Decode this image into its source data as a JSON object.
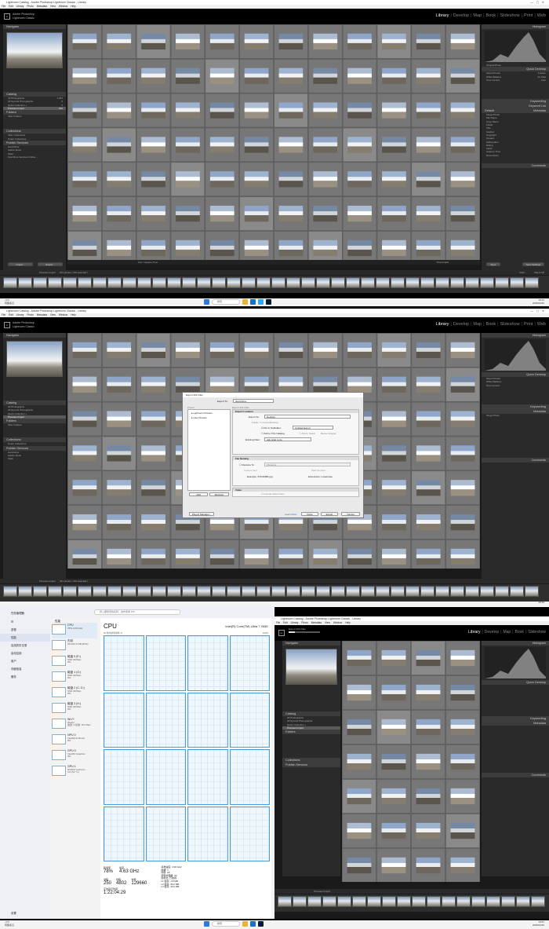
{
  "app": {
    "title": "Lightroom Catalog - Adobe Photoshop Lightroom Classic - Library",
    "brand_small": "Adobe Photoshop",
    "brand_name": "Lightroom Classic",
    "menus": [
      "File",
      "Edit",
      "Library",
      "Photo",
      "Metadata",
      "View",
      "Window",
      "Help"
    ],
    "modules": [
      "Library",
      "Develop",
      "Map",
      "Book",
      "Slideshow",
      "Print",
      "Web"
    ],
    "active_module": "Library"
  },
  "left_panel": {
    "navigator_label": "Navigator",
    "navigator_zoom": "FIT  FILL  1:1  3:1",
    "catalog_label": "Catalog",
    "catalog_items": [
      {
        "label": "All Photographs",
        "count": "1,251"
      },
      {
        "label": "All Synced Photographs",
        "count": "0"
      },
      {
        "label": "Quick Collection +",
        "count": "0"
      },
      {
        "label": "Previous Import",
        "count": "331"
      }
    ],
    "folders_label": "Folders",
    "filter_folders": "Filter Folders",
    "collections_label": "Collections",
    "filter_collections": "Filter Collections",
    "smart_collections": "Smart Collections",
    "publish_label": "Publish Services",
    "publish_items": [
      "Hard Drive",
      "Adobe Stock",
      "Flickr"
    ],
    "find_more": "Find More Services Online...",
    "import_btn": "Import...",
    "export_btn": "Export..."
  },
  "toolbar": {
    "sort_label": "Sort:",
    "sort_value": "Capture Time",
    "thumbnails_label": "Thumbnails"
  },
  "filmstrip_bar": {
    "source": "Previous Import",
    "count_text": "331 photos / 331 selected /",
    "filter_label": "Filter:",
    "filter_value": "Filters Off"
  },
  "right_panel": {
    "histogram_label": "Histogram",
    "histogram_info": "Original Photo",
    "quick_develop_label": "Quick Develop",
    "saved_preset_label": "Saved Preset",
    "saved_preset_value": "Custom",
    "white_balance_label": "White Balance",
    "white_balance_value": "As Shot",
    "tone_control_label": "Tone Control",
    "tone_control_value": "Auto",
    "keywording_label": "Keywording",
    "keyword_list_label": "Keyword List",
    "metadata_label": "Metadata",
    "metadata_preset": "Default",
    "target_photo": "Target Photo",
    "metadata_fields": [
      "File Name",
      "Copy Name",
      "Folder",
      "Title",
      "Caption",
      "Copyright",
      "Creator",
      "Sublocation",
      "Rating",
      "Label",
      "Capture Time",
      "Dimensions"
    ],
    "comments_label": "Comments",
    "sync_btn": "Sync",
    "sync_settings_btn": "Sync Settings"
  },
  "taskbar": {
    "search_placeholder": "搜索",
    "weather_temp": "-4°C",
    "weather_desc": "局部多云",
    "time_1": "10:21",
    "time_2": "10:34",
    "time_3": "10:51",
    "date": "2025/02/26"
  },
  "export_dialog": {
    "title": "Export 331 Files",
    "export_to_label": "Export To:",
    "export_to_value": "Hard Drive",
    "preset_label": "Preset:",
    "export_files_label": "Export 331 Files",
    "presets": [
      "Lightroom Presets",
      "User Presets"
    ],
    "add_btn": "Add",
    "remove_btn": "Remove",
    "location_hdr": "Export Location",
    "export_to_field": "Export To:",
    "export_to_field_value": "Desktop",
    "folder_label": "Folder:",
    "folder_value": "C:\\Users\\Desktop",
    "subfolder_check": "Put in Subfolder:",
    "subfolder_value": "Untitled Export",
    "add_catalog": "Add to This Catalog",
    "add_stack": "Add to Stack:",
    "below_original": "Below Original",
    "existing_label": "Existing Files:",
    "existing_value": "Ask what to do",
    "naming_hdr": "File Naming",
    "rename_to": "Rename To:",
    "rename_value": "Filename",
    "custom_text": "Custom Text:",
    "start_number": "Start Number:",
    "example_label": "Example:",
    "example_value": "STN10081.jpg",
    "extensions_label": "Extensions:",
    "extensions_value": "Lowercase",
    "video_hdr": "Video",
    "include_video": "Include Video Files:",
    "plugin_btn": "Plug-in Manager...",
    "learn_more": "Learn More",
    "done_btn": "Done",
    "export_btn": "Export",
    "cancel_btn": "Cancel"
  },
  "task_manager": {
    "title": "任务管理器",
    "search_placeholder": "键入要搜索的名称、发布者或 PID",
    "nav_items": [
      "进程",
      "性能",
      "应用历史记录",
      "启动应用",
      "用户",
      "详细信息",
      "服务"
    ],
    "settings_label": "设置",
    "section_title": "性能",
    "run_task_btn": "运行新任务",
    "perf_items": [
      {
        "name": "CPU",
        "value": "78%  4.63 GHz"
      },
      {
        "name": "内存",
        "value": "25.6/31.5 GB (81%)"
      },
      {
        "name": "磁盘 0 (E:)",
        "value": "SSD (NVMe)",
        "extra": "0%"
      },
      {
        "name": "磁盘 1 (G:)",
        "value": "SSD (NVMe)",
        "extra": "0%"
      },
      {
        "name": "磁盘 2 (C: D:)",
        "value": "SSD (NVMe)",
        "extra": "0%"
      },
      {
        "name": "磁盘 3 (H:)",
        "value": "SSD (NVMe)",
        "extra": "0%"
      },
      {
        "name": "Wi-Fi",
        "value": "WLAN",
        "extra": "发送: 0 接收: 8.0 Kbps"
      },
      {
        "name": "NPU 0",
        "value": "Intel(R) AI Boost",
        "extra": "0%"
      },
      {
        "name": "GPU 0",
        "value": "Intel(R) Graphics",
        "extra": "3%"
      },
      {
        "name": "GPU 1",
        "value": "NVIDIA GeForce ...",
        "extra": "1% (52 °C)"
      }
    ],
    "cpu_title": "CPU",
    "cpu_model": "Intel(R) Core(TM) Ultra 7 265K",
    "graph_caption": "60 秒内的利用率 %",
    "graph_max": "100%",
    "utilization_label": "利用率",
    "utilization_value": "78%",
    "speed_label": "速度",
    "speed_value": "4.63 GHz",
    "processes_label": "进程",
    "processes_value": "250",
    "threads_label": "线程",
    "threads_value": "4802",
    "handles_label": "句柄",
    "handles_value": "129660",
    "uptime_label": "正常运行时间",
    "uptime_value": "1:22:04:29",
    "base_speed_label": "基准速度:",
    "base_speed_value": "3.90 GHz",
    "sockets_label": "插槽:",
    "sockets_value": "1",
    "cores_label": "内核:",
    "cores_value": "20",
    "logical_label": "逻辑处理器:",
    "logical_value": "20",
    "virtualization_label": "虚拟化:",
    "virtualization_value": "已启用",
    "l1_label": "L1 缓存:",
    "l1_value": "1.8 MB",
    "l2_label": "L2 缓存:",
    "l2_value": "36.0 MB",
    "l3_label": "L3 缓存:",
    "l3_value": "30.0 MB"
  },
  "colors": {
    "lr_bg": "#1a1a1a",
    "lr_panel": "#2a2a2a",
    "grid_bg": "#6a6a6a",
    "tm_accent": "#4b9be0"
  }
}
